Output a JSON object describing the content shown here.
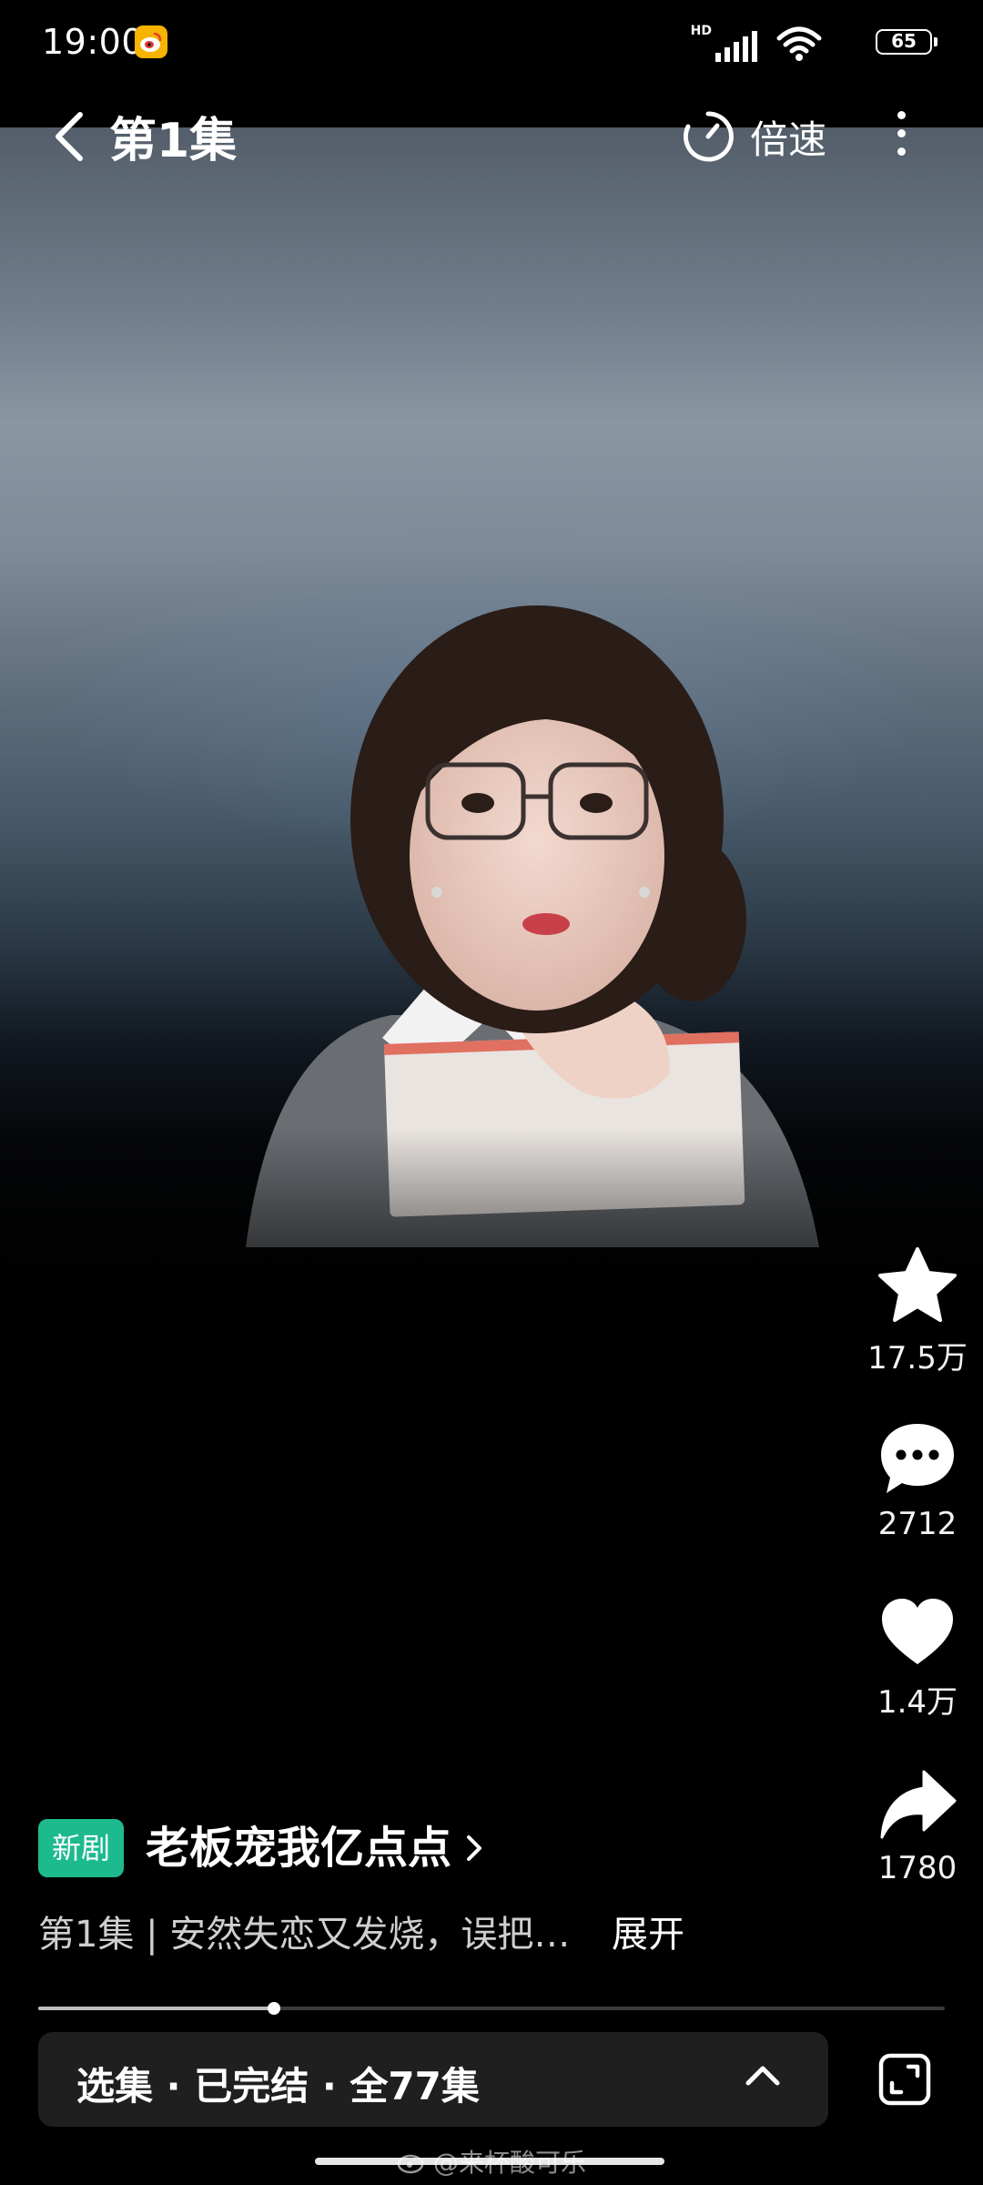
{
  "status_bar": {
    "time": "19:00",
    "network_label": "HD",
    "battery": "65",
    "icons": [
      "weibo-icon",
      "signal-icon",
      "wifi-icon",
      "battery-icon"
    ]
  },
  "nav": {
    "back_icon": "chevron-left-icon",
    "title": "第1集",
    "speed_icon": "timer-icon",
    "speed_label": "倍速",
    "more_icon": "more-vertical-icon"
  },
  "actions": [
    {
      "name": "favorite",
      "icon": "star-icon",
      "count": "17.5万"
    },
    {
      "name": "comment",
      "icon": "comment-icon",
      "count": "2712"
    },
    {
      "name": "like",
      "icon": "heart-icon",
      "count": "1.4万"
    },
    {
      "name": "share",
      "icon": "share-icon",
      "count": "1780"
    }
  ],
  "drama": {
    "tag": "新剧",
    "title": "老板宠我亿点点",
    "description": "第1集 | 安然失恋又发烧，误把…",
    "expand_label": "展开"
  },
  "progress": {
    "fraction": 0.26
  },
  "episodes_bar": {
    "label": "选集 · 已完结 · 全77集",
    "chevron_icon": "chevron-up-icon",
    "fullscreen_icon": "fullscreen-icon"
  },
  "watermark": "@来杯酸可乐",
  "colors": {
    "tag_green": "#1dba8e",
    "background": "#000000",
    "bar_background": "#1f1f1f"
  }
}
